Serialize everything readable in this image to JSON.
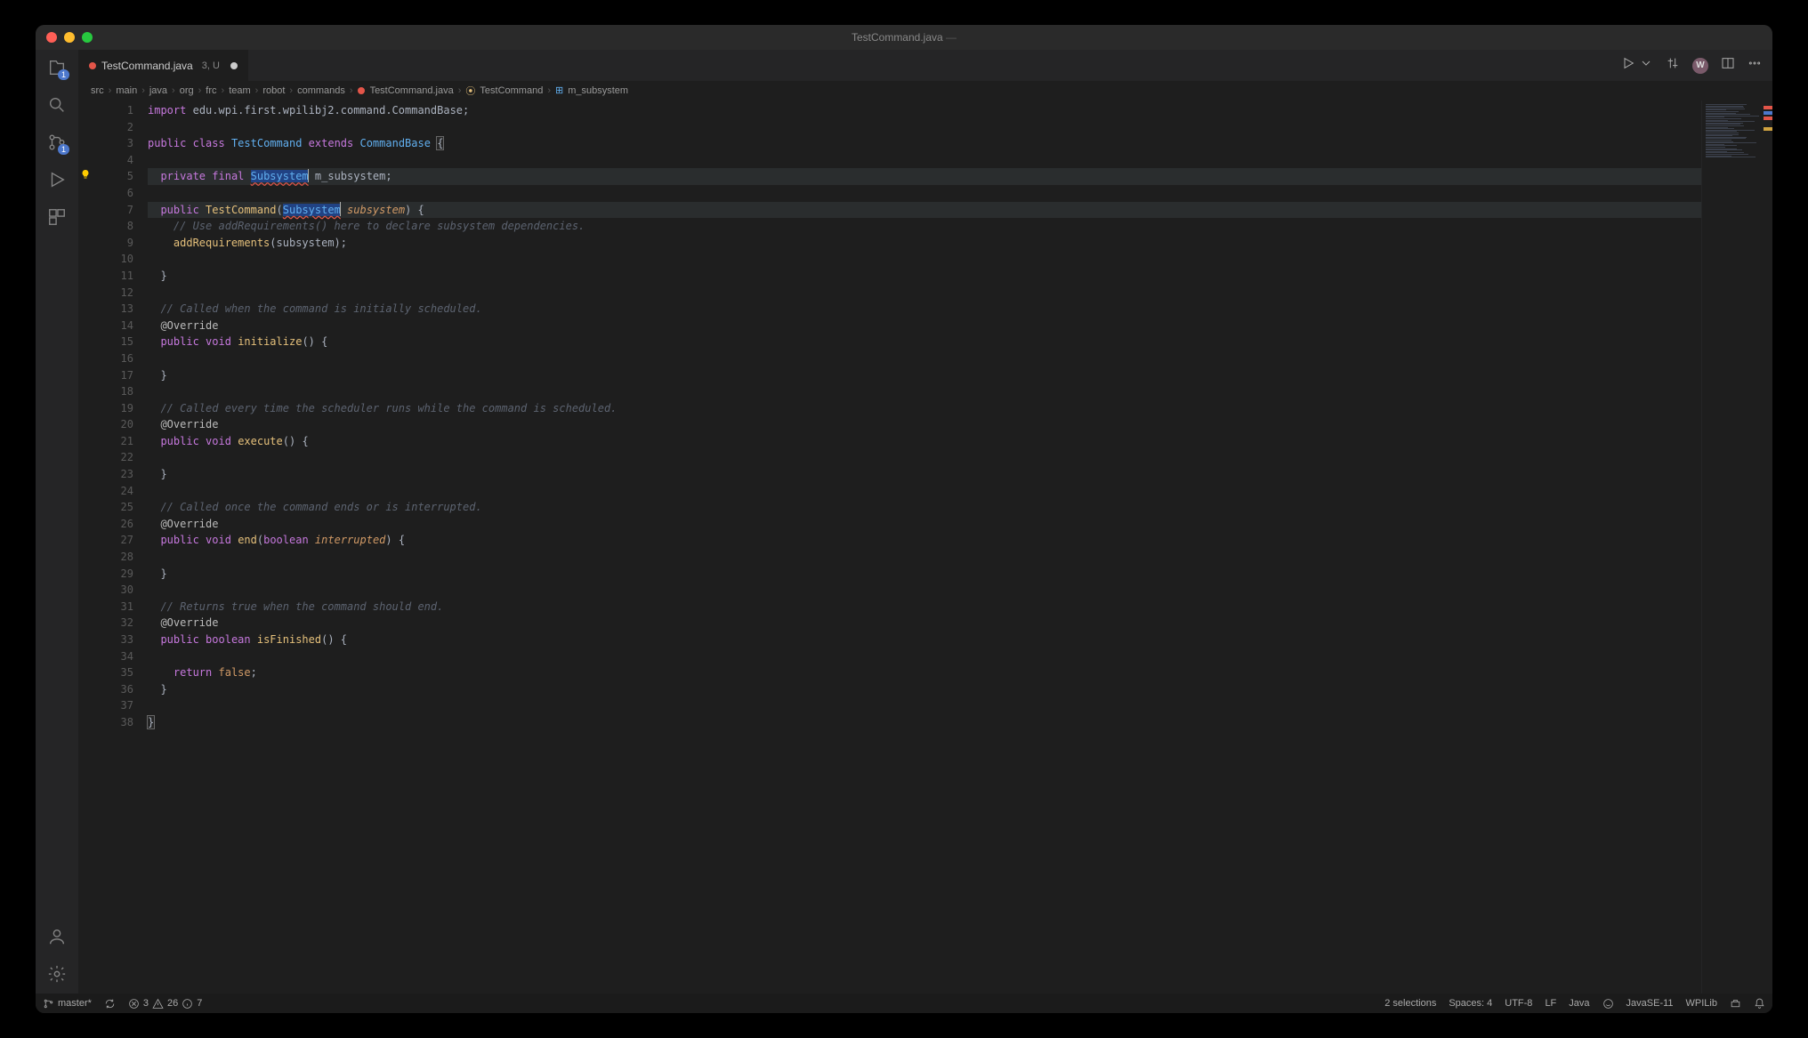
{
  "title": {
    "file": "TestCommand.java",
    "sep": "—",
    "project": ""
  },
  "tab": {
    "filename": "TestCommand.java",
    "meta": "3, U"
  },
  "activity_badges": {
    "explorer": "1",
    "scm": "1"
  },
  "breadcrumb": [
    "src",
    "main",
    "java",
    "org",
    "frc",
    "team",
    "robot",
    "commands",
    "TestCommand.java",
    "TestCommand",
    "m_subsystem"
  ],
  "code_lines": [
    {
      "n": 1,
      "html": "<span class='kw'>import</span> <span class='id'>edu.wpi.first.wpilibj2.command.CommandBase</span>;"
    },
    {
      "n": 2,
      "html": ""
    },
    {
      "n": 3,
      "html": "<span class='kw'>public</span> <span class='kw'>class</span> <span class='type'>TestCommand</span> <span class='kw'>extends</span> <span class='type'>CommandBase</span> <span class='bracket'>{</span>"
    },
    {
      "n": 4,
      "html": ""
    },
    {
      "n": 5,
      "hl": true,
      "bulb": true,
      "html": "  <span class='kw'>private</span> <span class='kw'>final</span> <span class='sel'><span class='type err-u'>Subsystem</span></span><span class='cursor'></span> <span class='id'>m_subsystem</span>;"
    },
    {
      "n": 6,
      "html": ""
    },
    {
      "n": 7,
      "hl": true,
      "html": "  <span class='kw'>public</span> <span class='fn'>TestCommand</span>(<span class='sel'><span class='type err-u'>Subsystem</span></span><span class='cursor'></span> <span class='param'>subsystem</span>) {"
    },
    {
      "n": 8,
      "html": "    <span class='com'>// Use addRequirements() here to declare subsystem dependencies.</span>"
    },
    {
      "n": 9,
      "html": "    <span class='fn'>addRequirements</span>(<span class='id'>subsystem</span>);"
    },
    {
      "n": 10,
      "html": ""
    },
    {
      "n": 11,
      "html": "  }"
    },
    {
      "n": 12,
      "html": ""
    },
    {
      "n": 13,
      "html": "  <span class='com'>// Called when the command is initially scheduled.</span>"
    },
    {
      "n": 14,
      "html": "  <span class='ann'>@Override</span>"
    },
    {
      "n": 15,
      "html": "  <span class='kw'>public</span> <span class='kw'>void</span> <span class='fn'>initialize</span>() {"
    },
    {
      "n": 16,
      "html": ""
    },
    {
      "n": 17,
      "html": "  }"
    },
    {
      "n": 18,
      "html": ""
    },
    {
      "n": 19,
      "html": "  <span class='com'>// Called every time the scheduler runs while the command is scheduled.</span>"
    },
    {
      "n": 20,
      "html": "  <span class='ann'>@Override</span>"
    },
    {
      "n": 21,
      "html": "  <span class='kw'>public</span> <span class='kw'>void</span> <span class='fn'>execute</span>() {"
    },
    {
      "n": 22,
      "html": ""
    },
    {
      "n": 23,
      "html": "  }"
    },
    {
      "n": 24,
      "html": ""
    },
    {
      "n": 25,
      "html": "  <span class='com'>// Called once the command ends or is interrupted.</span>"
    },
    {
      "n": 26,
      "html": "  <span class='ann'>@Override</span>"
    },
    {
      "n": 27,
      "html": "  <span class='kw'>public</span> <span class='kw'>void</span> <span class='fn'>end</span>(<span class='kw'>boolean</span> <span class='param'>interrupted</span>) {"
    },
    {
      "n": 28,
      "html": ""
    },
    {
      "n": 29,
      "html": "  }"
    },
    {
      "n": 30,
      "html": ""
    },
    {
      "n": 31,
      "html": "  <span class='com'>// Returns true when the command should end.</span>"
    },
    {
      "n": 32,
      "html": "  <span class='ann'>@Override</span>"
    },
    {
      "n": 33,
      "html": "  <span class='kw'>public</span> <span class='kw'>boolean</span> <span class='fn'>isFinished</span>() {"
    },
    {
      "n": 34,
      "html": ""
    },
    {
      "n": 35,
      "html": "    <span class='kw'>return</span> <span class='lit'>false</span>;"
    },
    {
      "n": 36,
      "html": "  }"
    },
    {
      "n": 37,
      "html": ""
    },
    {
      "n": 38,
      "html": "<span class='bracket'>}</span>"
    }
  ],
  "status": {
    "branch": "master*",
    "errors": "3",
    "warnings": "26",
    "info": "7",
    "selections": "2 selections",
    "spaces": "Spaces: 4",
    "encoding": "UTF-8",
    "eol": "LF",
    "lang": "Java",
    "jdk": "JavaSE-11",
    "ext": "WPILib"
  }
}
